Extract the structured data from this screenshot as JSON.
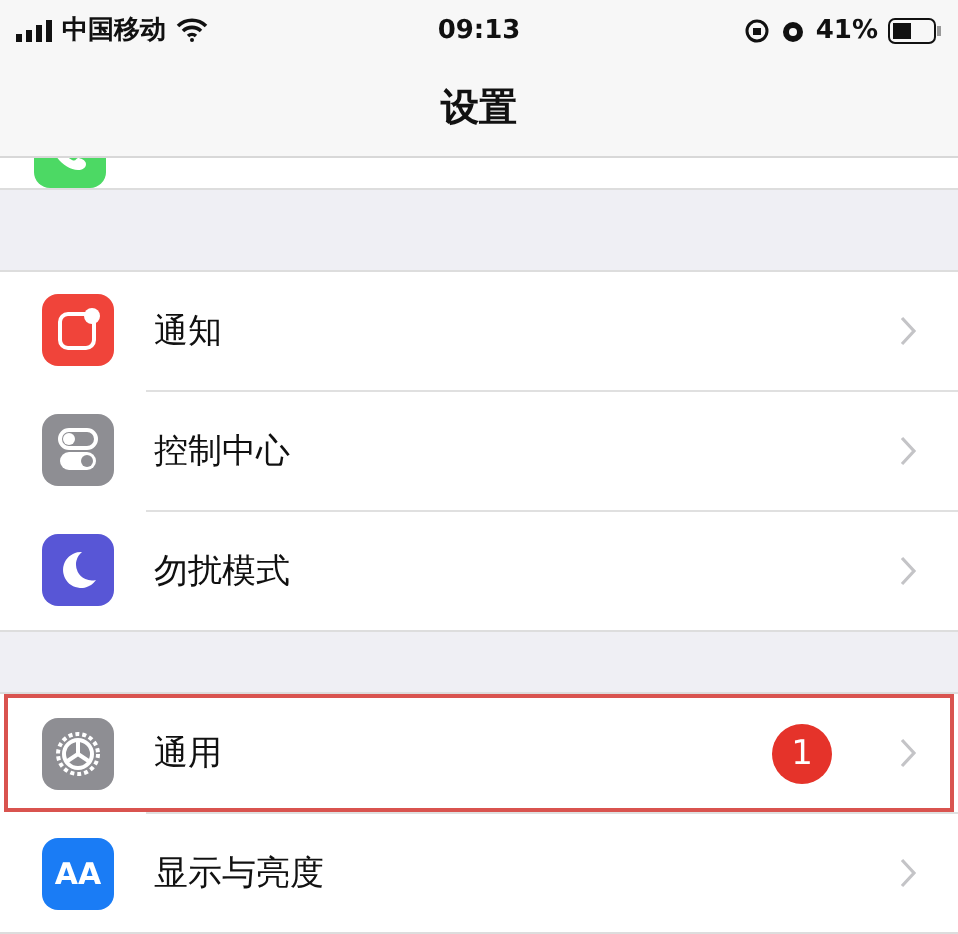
{
  "status_bar": {
    "carrier": "中国移动",
    "time": "09:13",
    "battery": "41%"
  },
  "nav": {
    "title": "设置"
  },
  "partial_row": {
    "kind": "phone"
  },
  "groups": [
    [
      {
        "kind": "notifications",
        "label": "通知",
        "highlighted": false
      },
      {
        "kind": "control",
        "label": "控制中心",
        "highlighted": false
      },
      {
        "kind": "moon",
        "label": "勿扰模式",
        "highlighted": false
      }
    ],
    [
      {
        "kind": "gear",
        "label": "通用",
        "badge": "1",
        "highlighted": true
      },
      {
        "kind": "display",
        "icon_text": "AA",
        "label": "显示与亮度",
        "highlighted": false
      }
    ]
  ]
}
